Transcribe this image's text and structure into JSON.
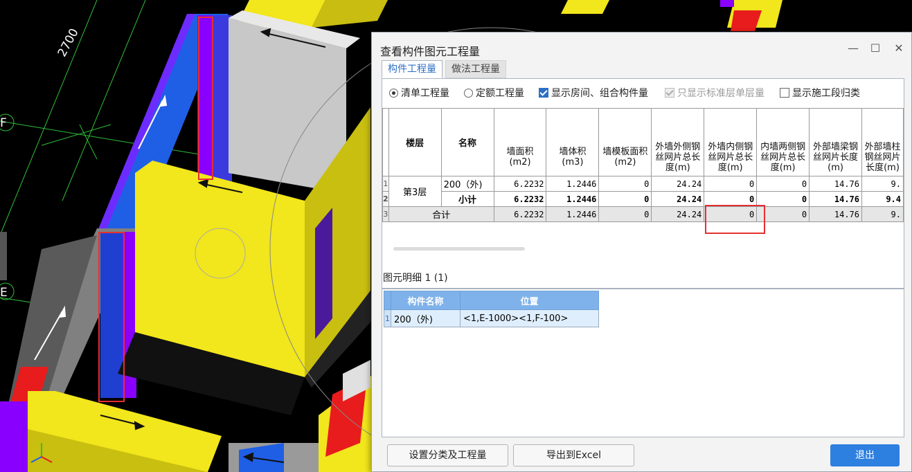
{
  "viewport": {
    "dimension_label": "2700",
    "grid_labels": [
      "F",
      "E"
    ]
  },
  "dialog": {
    "title": "查看构件图元工程量",
    "window_buttons": {
      "minimize": "—",
      "maximize": "☐",
      "close": "✕"
    },
    "tabs": [
      {
        "label": "构件工程量",
        "active": true
      },
      {
        "label": "做法工程量",
        "active": false
      }
    ],
    "options": [
      {
        "label": "清单工程量",
        "kind": "radio",
        "checked": true,
        "disabled": false
      },
      {
        "label": "定额工程量",
        "kind": "radio",
        "checked": false,
        "disabled": false
      },
      {
        "label": "显示房间、组合构件量",
        "kind": "checkbox",
        "checked": true,
        "disabled": false
      },
      {
        "label": "只显示标准层单层量",
        "kind": "checkbox",
        "checked": true,
        "disabled": true
      },
      {
        "label": "显示施工段归类",
        "kind": "checkbox",
        "checked": false,
        "disabled": false
      }
    ],
    "table": {
      "headers": {
        "floor": "楼层",
        "name": "名称",
        "wall_area": "墙面积(m2)",
        "wall_volume": "墙体积(m3)",
        "formwork_area": "墙模板面积(m2)",
        "ext_outer_mesh": "外墙外侧钢丝网片总长度(m)",
        "ext_inner_mesh": "外墙内侧钢丝网片总长度(m)",
        "int_both_mesh": "内墙两侧钢丝网片总长度(m)",
        "ext_beam_mesh": "外部墙梁钢丝网片长度(m)",
        "ext_col_mesh": "外部墙柱钢丝网片长度(m)"
      },
      "row_numbers": [
        "1",
        "2",
        "3"
      ],
      "floor_value": "第3层",
      "rows": [
        {
          "name": "200（外)",
          "wall_area": "6.2232",
          "wall_volume": "1.2446",
          "formwork_area": "0",
          "ext_outer_mesh": "24.24",
          "ext_inner_mesh": "0",
          "int_both_mesh": "0",
          "ext_beam_mesh": "14.76",
          "ext_col_mesh": "9."
        },
        {
          "name": "小计",
          "wall_area": "6.2232",
          "wall_volume": "1.2446",
          "formwork_area": "0",
          "ext_outer_mesh": "24.24",
          "ext_inner_mesh": "0",
          "int_both_mesh": "0",
          "ext_beam_mesh": "14.76",
          "ext_col_mesh": "9.4"
        },
        {
          "name": "合计",
          "wall_area": "6.2232",
          "wall_volume": "1.2446",
          "formwork_area": "0",
          "ext_outer_mesh": "24.24",
          "ext_inner_mesh": "0",
          "int_both_mesh": "0",
          "ext_beam_mesh": "14.76",
          "ext_col_mesh": "9."
        }
      ]
    },
    "detail": {
      "label": "图元明细  1 (1)",
      "headers": {
        "component_name": "构件名称",
        "position": "位置"
      },
      "rows": [
        {
          "num": "1",
          "component_name": "200（外)",
          "position": "<1,E-1000><1,F-100>"
        }
      ]
    },
    "buttons": {
      "set_category": "设置分类及工程量",
      "export_excel": "导出到Excel",
      "exit": "退出"
    }
  },
  "colors": {
    "accent": "#2d7fe0",
    "highlight_red": "#e53030",
    "wall_yellow": "#f2e61c",
    "wall_blue": "#1f5fe6",
    "wall_purple": "#8a00ff"
  }
}
